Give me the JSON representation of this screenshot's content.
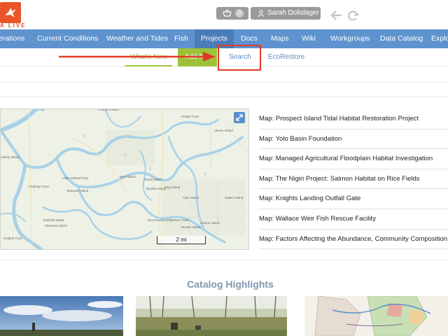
{
  "header": {
    "logo_text": "A LIVE",
    "cart_count": "0",
    "user_name": "Sarah Dolislager"
  },
  "mainnav": {
    "items": [
      {
        "label": "erations"
      },
      {
        "label": "Current Conditions"
      },
      {
        "label": "Weather and Tides"
      },
      {
        "label": "Fish"
      },
      {
        "label": "Projects"
      },
      {
        "label": "Docs"
      },
      {
        "label": "Maps"
      },
      {
        "label": "Wiki"
      },
      {
        "label": "Workgroups"
      },
      {
        "label": "Data Catalog"
      },
      {
        "label": "Explor"
      }
    ],
    "active": "Projects"
  },
  "subnav": {
    "whats_new": "What's New",
    "add_new": "Add New",
    "search": "Search",
    "ecorestore": "EcoRestore"
  },
  "map": {
    "scale_label": "2 mi",
    "place_labels": [
      "Prospect Island",
      "Liberty Island",
      "Little Holland Tract",
      "Hastings Tract",
      "Ryer Island",
      "Grand Island",
      "Tyler Island",
      "Staten Island",
      "Brannan Island",
      "Twitchell Island",
      "Sherman Island",
      "Holland Tract",
      "Empire Tract",
      "Venice Island",
      "King Island",
      "Bouldin Island",
      "McCormack-Williamson Tract",
      "Andrus Island",
      "Decker Island"
    ]
  },
  "maplist": {
    "items": [
      "Map: Prospect Island Tidal Habitat Restoration Project",
      "Map: Yolo Basin Foundation",
      "Map: Managed Agricultural Floodplain Habitat Investigation",
      "Map: The Nigiri Project: Salmon Habitat on Rice Fields",
      "Map: Knights Landing Outfall Gate",
      "Map: Wallace Weir Fish Rescue Facility",
      "Map: Factors Affecting the Abundance, Community Composition, Dis"
    ]
  },
  "catalog": {
    "title": "Catalog Highlights"
  },
  "colors": {
    "nav_blue": "#5e93cf",
    "nav_active": "#4a7db8",
    "green_accent": "#9dc23a",
    "highlight_red": "#e23a2a",
    "logo_orange": "#e8562a"
  }
}
